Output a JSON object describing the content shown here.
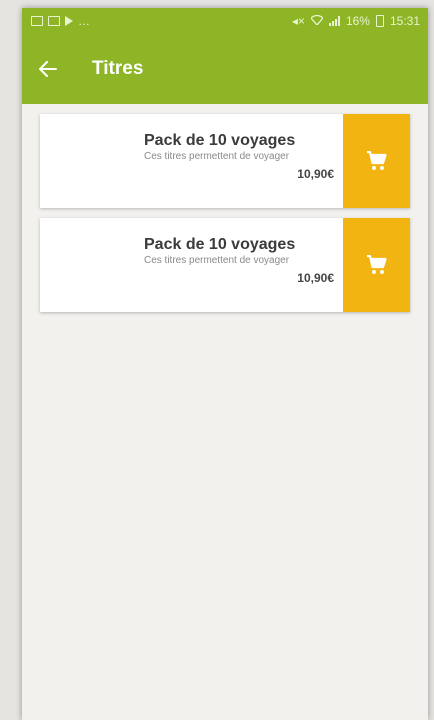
{
  "status_bar": {
    "battery_percent": "16%",
    "time": "15:31",
    "icons": [
      "image-icon",
      "mail-icon",
      "play-icon",
      "more-dots-icon",
      "mute-icon",
      "wifi-icon",
      "signal-icon",
      "battery-icon"
    ]
  },
  "app_bar": {
    "back_icon": "arrow-left-icon",
    "title": "Titres"
  },
  "products": [
    {
      "name": "Pack de 10 voyages",
      "description": "Ces titres permettent de voyager",
      "price": "10,90€",
      "action_icon": "cart-icon"
    },
    {
      "name": "Pack de 10 voyages",
      "description": "Ces titres permettent de voyager",
      "price": "10,90€",
      "action_icon": "cart-icon"
    }
  ],
  "colors": {
    "app_bar": "#8db526",
    "cart_button": "#f2b411",
    "background": "#f3f1ee"
  }
}
